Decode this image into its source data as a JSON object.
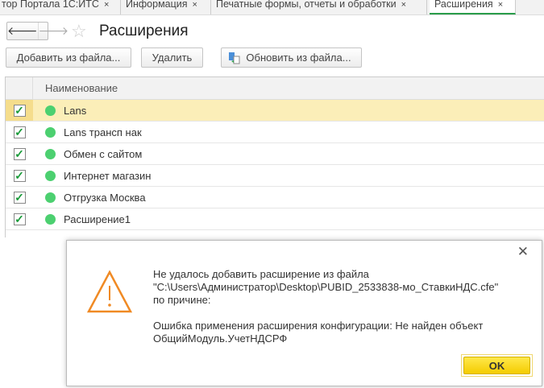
{
  "tabs": [
    {
      "label": "тор Портала 1С:ИТС"
    },
    {
      "label": "Информация"
    },
    {
      "label": "Печатные формы, отчеты и обработки"
    },
    {
      "label": "Расширения",
      "active": true
    }
  ],
  "tab_close": "×",
  "header": {
    "title": "Расширения",
    "back": "🡐",
    "forward": "🡒",
    "star": "☆"
  },
  "toolbar": {
    "add": "Добавить из файла...",
    "delete": "Удалить",
    "update": "Обновить из файла..."
  },
  "table": {
    "column": "Наименование",
    "rows": [
      {
        "name": "Lans",
        "checked": true,
        "selected": true
      },
      {
        "name": "Lans трансп нак",
        "checked": true
      },
      {
        "name": "Обмен с сайтом",
        "checked": true
      },
      {
        "name": "Интернет магазин",
        "checked": true
      },
      {
        "name": "Отгрузка Москва",
        "checked": true
      },
      {
        "name": "Расширение1",
        "checked": true
      }
    ]
  },
  "check": "✓",
  "dialog": {
    "line1": "Не удалось добавить расширение из файла",
    "line2": "\"C:\\Users\\Администратор\\Desktop\\PUBID_2533838-мо_СтавкиНДС.cfe\"",
    "line3": "по причине:",
    "line4": "Ошибка применения расширения конфигурации: Не найден объект",
    "line5": "ОбщийМодуль.УчетНДСРФ",
    "ok": "OK",
    "close": "✕"
  },
  "colors": {
    "accent": "#2a9d4a",
    "status": "#4cd070",
    "warning": "#f08a24",
    "ok": "#f4cc00"
  }
}
